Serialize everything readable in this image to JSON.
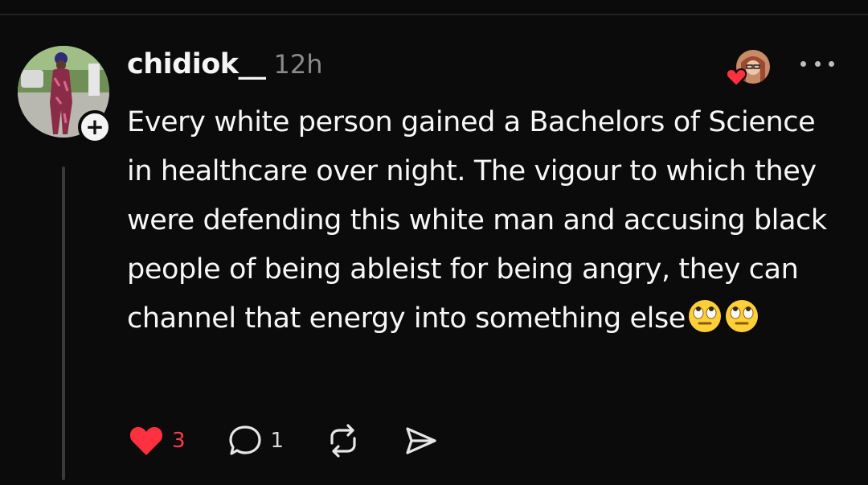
{
  "post": {
    "username": "chidiok__",
    "timestamp": "12h",
    "text": "Every white person gained a Bachelors of Science in healthcare over night. The vigour to which they were defending this white man and accusing black people of being ableist for being angry, they can channel that energy into something else",
    "trailing_emojis": [
      "face-with-rolling-eyes",
      "face-with-rolling-eyes"
    ],
    "follow_badge": "+"
  },
  "actions": {
    "like_count": "3",
    "reply_count": "1"
  },
  "icons": {
    "like": "heart-icon",
    "reply": "comment-bubble-icon",
    "repost": "repost-icon",
    "share": "send-icon",
    "more": "more-dots-icon"
  },
  "colors": {
    "background": "#0b0b0b",
    "text": "#f7f7f7",
    "muted": "#8a8a8a",
    "like": "#ff3b4a"
  }
}
